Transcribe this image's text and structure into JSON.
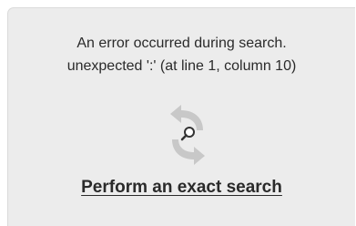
{
  "error": {
    "line1": "An error occurred during search.",
    "line2": "unexpected ':' (at line 1, column 10)"
  },
  "icon": "refresh-search-icon",
  "action": {
    "exact_search_label": "Perform an exact search"
  }
}
